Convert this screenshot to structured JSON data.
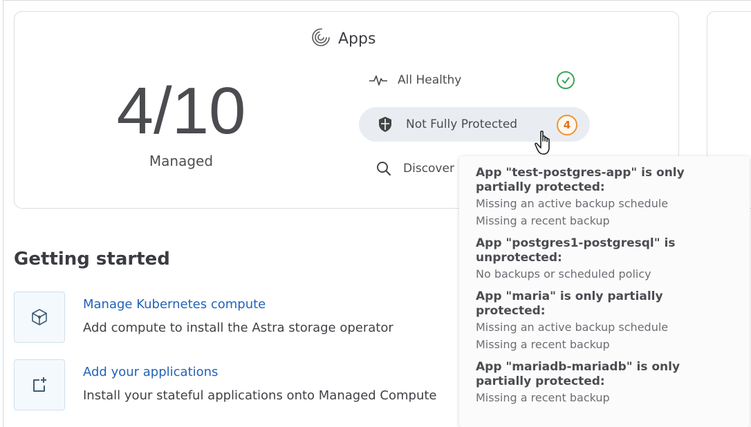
{
  "apps_card": {
    "title": "Apps",
    "managed_count": "4/10",
    "managed_label": "Managed",
    "status": [
      {
        "label": "All Healthy",
        "icon": "heartbeat-icon",
        "badge": "check-icon"
      },
      {
        "label": "Not Fully Protected",
        "icon": "shield-icon",
        "badge_count": "4"
      },
      {
        "label": "Discover",
        "icon": "search-icon"
      }
    ]
  },
  "tooltip": {
    "items": [
      {
        "title": "App \"test-postgres-app\" is only partially protected:",
        "lines": [
          "Missing an active backup schedule",
          "Missing a recent backup"
        ]
      },
      {
        "title": "App \"postgres1-postgresql\" is unprotected:",
        "lines": [
          "No backups or scheduled policy"
        ]
      },
      {
        "title": "App \"maria\" is only partially protected:",
        "lines": [
          "Missing an active backup schedule",
          "Missing a recent backup"
        ]
      },
      {
        "title": "App \"mariadb-mariadb\" is only partially protected:",
        "lines": [
          "Missing a recent backup"
        ]
      }
    ]
  },
  "getting_started": {
    "heading": "Getting started",
    "items": [
      {
        "link": "Manage Kubernetes compute",
        "description": "Add compute to install the Astra storage operator",
        "icon": "cube-icon"
      },
      {
        "link": "Add your applications",
        "description": "Install your stateful applications onto Managed Compute",
        "icon": "add-app-icon"
      }
    ]
  },
  "colors": {
    "link": "#2163b6",
    "healthy": "#3aa45a",
    "warning": "#f0932f",
    "highlight": "#e9edf2"
  }
}
